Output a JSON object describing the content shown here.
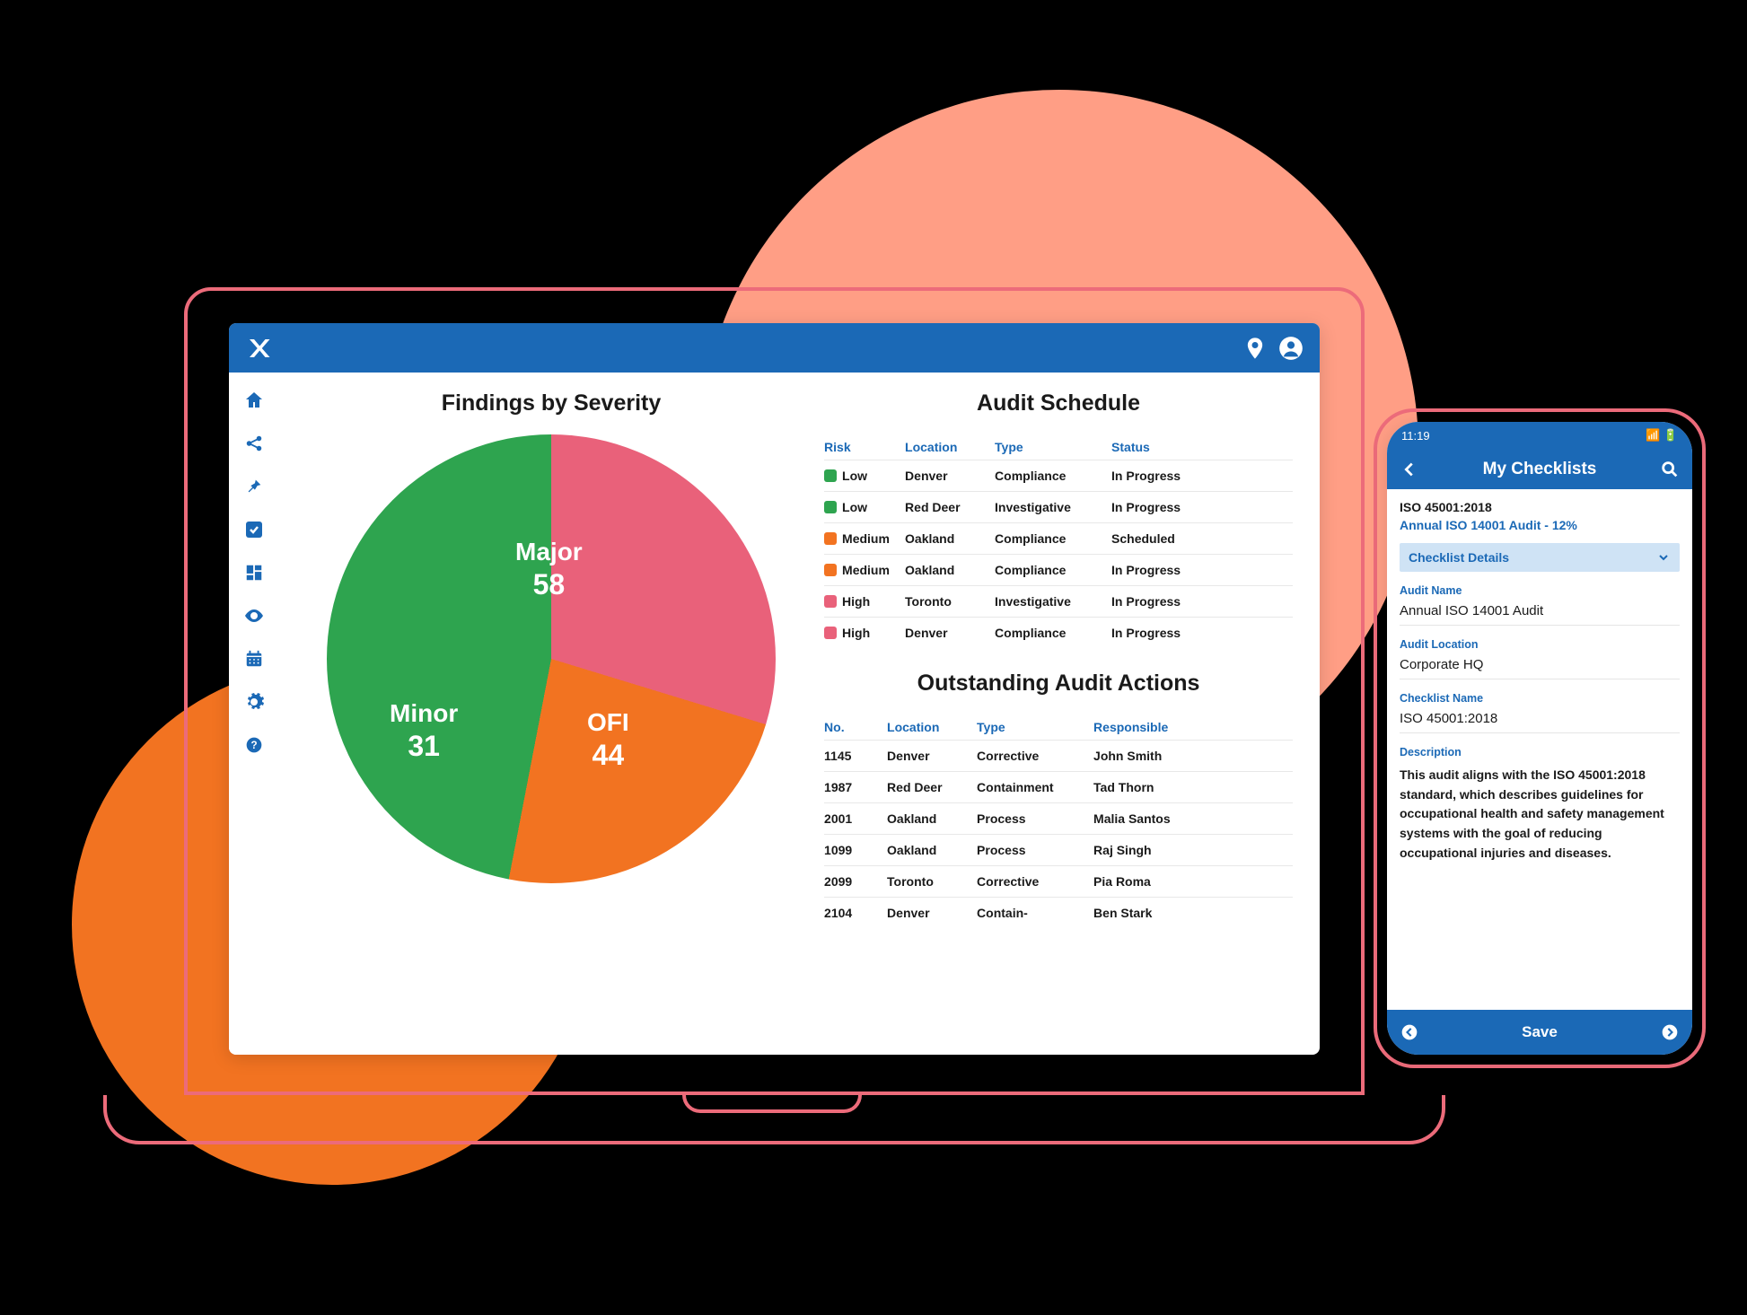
{
  "colors": {
    "brand": "#1b69b6",
    "major": "#e9617a",
    "minor": "#f27321",
    "ofi": "#2ea44f",
    "low": "#2ea44f",
    "medium": "#f27321",
    "high": "#e9617a"
  },
  "laptop": {
    "sidebar": {
      "icons": [
        "home",
        "share",
        "pin",
        "check",
        "grid",
        "eye",
        "calendar",
        "settings",
        "help"
      ]
    },
    "chart": {
      "title": "Findings by Severity"
    },
    "audit_schedule": {
      "title": "Audit Schedule",
      "headers": {
        "risk": "Risk",
        "location": "Location",
        "type": "Type",
        "status": "Status"
      },
      "rows": [
        {
          "risk": "Low",
          "risk_color": "#2ea44f",
          "location": "Denver",
          "type": "Compliance",
          "status": "In Progress"
        },
        {
          "risk": "Low",
          "risk_color": "#2ea44f",
          "location": "Red Deer",
          "type": "Investigative",
          "status": "In Progress"
        },
        {
          "risk": "Medium",
          "risk_color": "#f27321",
          "location": "Oakland",
          "type": "Compliance",
          "status": "Scheduled"
        },
        {
          "risk": "Medium",
          "risk_color": "#f27321",
          "location": "Oakland",
          "type": "Compliance",
          "status": "In Progress"
        },
        {
          "risk": "High",
          "risk_color": "#e9617a",
          "location": "Toronto",
          "type": "Investigative",
          "status": "In Progress"
        },
        {
          "risk": "High",
          "risk_color": "#e9617a",
          "location": "Denver",
          "type": "Compliance",
          "status": "In Progress"
        }
      ]
    },
    "outstanding": {
      "title": "Outstanding Audit Actions",
      "headers": {
        "no": "No.",
        "location": "Location",
        "type": "Type",
        "responsible": "Responsible"
      },
      "rows": [
        {
          "no": "1145",
          "location": "Denver",
          "type": "Corrective",
          "responsible": "John Smith"
        },
        {
          "no": "1987",
          "location": "Red Deer",
          "type": "Containment",
          "responsible": "Tad Thorn"
        },
        {
          "no": "2001",
          "location": "Oakland",
          "type": "Process",
          "responsible": "Malia Santos"
        },
        {
          "no": "1099",
          "location": "Oakland",
          "type": "Process",
          "responsible": "Raj Singh"
        },
        {
          "no": "2099",
          "location": "Toronto",
          "type": "Corrective",
          "responsible": "Pia Roma"
        },
        {
          "no": "2104",
          "location": "Denver",
          "type": "Contain-",
          "responsible": "Ben Stark"
        }
      ]
    }
  },
  "chart_data": {
    "type": "pie",
    "title": "Findings by Severity",
    "categories": [
      "Major",
      "Minor",
      "OFI"
    ],
    "values": [
      58,
      31,
      44
    ],
    "colors": [
      "#e9617a",
      "#f27321",
      "#2ea44f"
    ]
  },
  "phone": {
    "status_time": "11:19",
    "header_title": "My Checklists",
    "line1": "ISO 45001:2018",
    "line2": "Annual ISO 14001 Audit - 12%",
    "accordion": "Checklist Details",
    "fields": {
      "audit_name_label": "Audit Name",
      "audit_name_value": "Annual ISO 14001 Audit",
      "audit_location_label": "Audit Location",
      "audit_location_value": "Corporate HQ",
      "checklist_name_label": "Checklist Name",
      "checklist_name_value": "ISO 45001:2018",
      "description_label": "Description",
      "description_value": "This audit aligns with the ISO 45001:2018 standard, which describes guidelines for occupational health and safety management systems with the goal of reducing occupational injuries and diseases."
    },
    "footer": {
      "save": "Save"
    }
  }
}
